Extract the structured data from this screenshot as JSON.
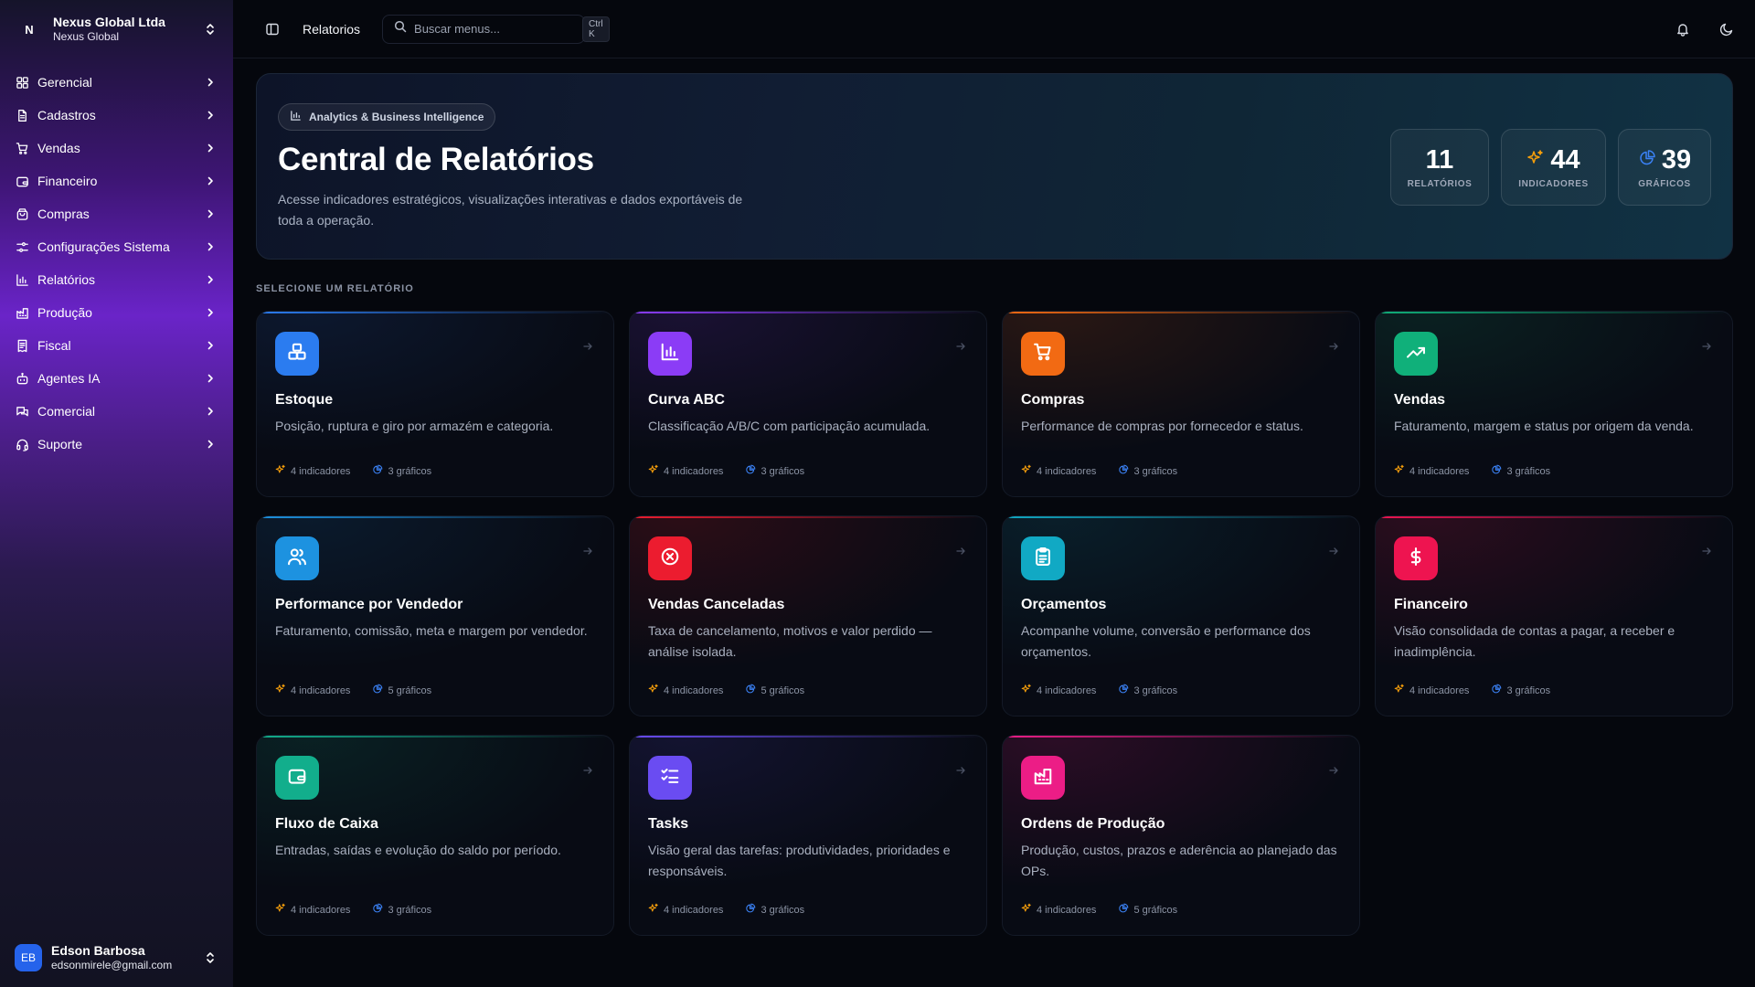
{
  "org": {
    "logo": "N",
    "name": "Nexus Global Ltda",
    "sub": "Nexus Global"
  },
  "menu": [
    {
      "label": "Gerencial",
      "icon": "dashboard-icon"
    },
    {
      "label": "Cadastros",
      "icon": "file-icon"
    },
    {
      "label": "Vendas",
      "icon": "cart-icon"
    },
    {
      "label": "Financeiro",
      "icon": "wallet-icon"
    },
    {
      "label": "Compras",
      "icon": "bag-icon"
    },
    {
      "label": "Configurações Sistema",
      "icon": "sliders-icon"
    },
    {
      "label": "Relatórios",
      "icon": "bar-chart-icon"
    },
    {
      "label": "Produção",
      "icon": "factory-icon"
    },
    {
      "label": "Fiscal",
      "icon": "receipt-icon"
    },
    {
      "label": "Agentes IA",
      "icon": "bot-icon"
    },
    {
      "label": "Comercial",
      "icon": "chat-icon"
    },
    {
      "label": "Suporte",
      "icon": "headset-icon"
    }
  ],
  "user": {
    "initials": "EB",
    "name": "Edson Barbosa",
    "email": "edsonmirele@gmail.com"
  },
  "topbar": {
    "crumb": "Relatorios",
    "search_placeholder": "Buscar menus...",
    "shortcut": "Ctrl K"
  },
  "hero": {
    "badge": "Analytics & Business Intelligence",
    "title": "Central de Relatórios",
    "description": "Acesse indicadores estratégicos, visualizações interativas e dados exportáveis de toda a operação.",
    "stats": [
      {
        "value": "11",
        "label": "RELATÓRIOS"
      },
      {
        "value": "44",
        "label": "INDICADORES"
      },
      {
        "value": "39",
        "label": "GRÁFICOS"
      }
    ]
  },
  "section_label": "SELECIONE UM RELATÓRIO",
  "colors": {
    "accent": "#6a24c8",
    "indicator": "#f59e0b",
    "chart": "#3b82f6"
  },
  "cards": [
    {
      "title": "Estoque",
      "description": "Posição, ruptura e giro por armazém e categoria.",
      "indicators": "4 indicadores",
      "charts": "3 gráficos",
      "icon": "boxes-icon",
      "color": "#2b7cf0",
      "glow": "rgba(30,70,140,0.22)"
    },
    {
      "title": "Curva ABC",
      "description": "Classificação A/B/C com participação acumulada.",
      "indicators": "4 indicadores",
      "charts": "3 gráficos",
      "icon": "bar-chart-icon",
      "color": "#8b3cf6",
      "glow": "rgba(90,40,160,0.22)"
    },
    {
      "title": "Compras",
      "description": "Performance de compras por fornecedor e status.",
      "indicators": "4 indicadores",
      "charts": "3 gráficos",
      "icon": "cart-icon",
      "color": "#f26a13",
      "glow": "rgba(140,60,20,0.25)"
    },
    {
      "title": "Vendas",
      "description": "Faturamento, margem e status por origem da venda.",
      "indicators": "4 indicadores",
      "charts": "3 gráficos",
      "icon": "trending-up-icon",
      "color": "#10b07a",
      "glow": "rgba(20,110,80,0.22)"
    },
    {
      "title": "Performance por Vendedor",
      "description": "Faturamento, comissão, meta e margem por vendedor.",
      "indicators": "4 indicadores",
      "charts": "5 gráficos",
      "icon": "users-icon",
      "color": "#1d92e0",
      "glow": "rgba(20,80,130,0.22)"
    },
    {
      "title": "Vendas Canceladas",
      "description": "Taxa de cancelamento, motivos e valor perdido — análise isolada.",
      "indicators": "4 indicadores",
      "charts": "5 gráficos",
      "icon": "x-circle-icon",
      "color": "#ec1c2f",
      "glow": "rgba(150,20,30,0.25)"
    },
    {
      "title": "Orçamentos",
      "description": "Acompanhe volume, conversão e performance dos orçamentos.",
      "indicators": "4 indicadores",
      "charts": "3 gráficos",
      "icon": "clipboard-icon",
      "color": "#11a9c4",
      "glow": "rgba(15,100,120,0.22)"
    },
    {
      "title": "Financeiro",
      "description": "Visão consolidada de contas a pagar, a receber e inadimplência.",
      "indicators": "4 indicadores",
      "charts": "3 gráficos",
      "icon": "dollar-icon",
      "color": "#ee1450",
      "glow": "rgba(150,20,60,0.25)"
    },
    {
      "title": "Fluxo de Caixa",
      "description": "Entradas, saídas e evolução do saldo por período.",
      "indicators": "4 indicadores",
      "charts": "3 gráficos",
      "icon": "wallet-icon",
      "color": "#12ae8c",
      "glow": "rgba(15,110,90,0.22)"
    },
    {
      "title": "Tasks",
      "description": "Visão geral das tarefas: produtividades, prioridades e responsáveis.",
      "indicators": "4 indicadores",
      "charts": "3 gráficos",
      "icon": "checklist-icon",
      "color": "#6a4cf2",
      "glow": "rgba(60,50,150,0.22)"
    },
    {
      "title": "Ordens de Produção",
      "description": "Produção, custos, prazos e aderência ao planejado das OPs.",
      "indicators": "4 indicadores",
      "charts": "5 gráficos",
      "icon": "factory-icon",
      "color": "#ec1d86",
      "glow": "rgba(150,20,90,0.25)"
    }
  ]
}
